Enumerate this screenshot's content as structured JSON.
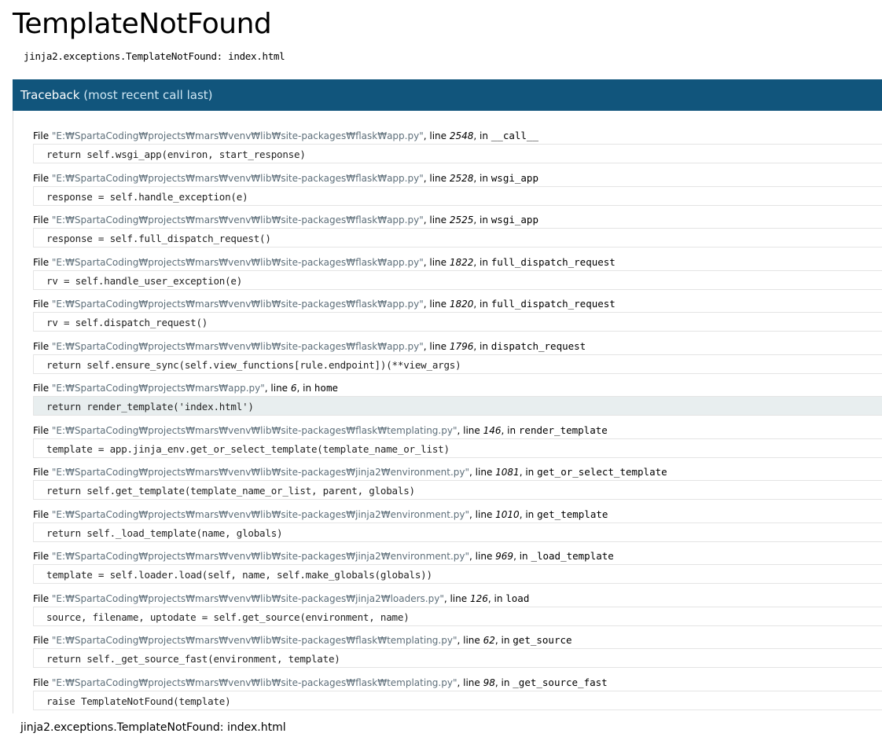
{
  "title": "TemplateNotFound",
  "error_message": "jinja2.exceptions.TemplateNotFound: index.html",
  "traceback": {
    "heading": "Traceback",
    "subheading": "(most recent call last)"
  },
  "frames": [
    {
      "file": "\"E:₩SpartaCoding₩projects₩mars₩venv₩lib₩site-packages₩flask₩app.py\"",
      "line": "2548",
      "func": "__call__",
      "code": "return self.wsgi_app(environ, start_response)"
    },
    {
      "file": "\"E:₩SpartaCoding₩projects₩mars₩venv₩lib₩site-packages₩flask₩app.py\"",
      "line": "2528",
      "func": "wsgi_app",
      "code": "response = self.handle_exception(e)"
    },
    {
      "file": "\"E:₩SpartaCoding₩projects₩mars₩venv₩lib₩site-packages₩flask₩app.py\"",
      "line": "2525",
      "func": "wsgi_app",
      "code": "response = self.full_dispatch_request()"
    },
    {
      "file": "\"E:₩SpartaCoding₩projects₩mars₩venv₩lib₩site-packages₩flask₩app.py\"",
      "line": "1822",
      "func": "full_dispatch_request",
      "code": "rv = self.handle_user_exception(e)"
    },
    {
      "file": "\"E:₩SpartaCoding₩projects₩mars₩venv₩lib₩site-packages₩flask₩app.py\"",
      "line": "1820",
      "func": "full_dispatch_request",
      "code": "rv = self.dispatch_request()"
    },
    {
      "file": "\"E:₩SpartaCoding₩projects₩mars₩venv₩lib₩site-packages₩flask₩app.py\"",
      "line": "1796",
      "func": "dispatch_request",
      "code": "return self.ensure_sync(self.view_functions[rule.endpoint])(**view_args)"
    },
    {
      "file": "\"E:₩SpartaCoding₩projects₩mars₩app.py\"",
      "line": "6",
      "func": "home",
      "code": "return render_template('index.html')",
      "highlight": true
    },
    {
      "file": "\"E:₩SpartaCoding₩projects₩mars₩venv₩lib₩site-packages₩flask₩templating.py\"",
      "line": "146",
      "func": "render_template",
      "code": "template = app.jinja_env.get_or_select_template(template_name_or_list)"
    },
    {
      "file": "\"E:₩SpartaCoding₩projects₩mars₩venv₩lib₩site-packages₩jinja2₩environment.py\"",
      "line": "1081",
      "func": "get_or_select_template",
      "code": "return self.get_template(template_name_or_list, parent, globals)"
    },
    {
      "file": "\"E:₩SpartaCoding₩projects₩mars₩venv₩lib₩site-packages₩jinja2₩environment.py\"",
      "line": "1010",
      "func": "get_template",
      "code": "return self._load_template(name, globals)"
    },
    {
      "file": "\"E:₩SpartaCoding₩projects₩mars₩venv₩lib₩site-packages₩jinja2₩environment.py\"",
      "line": "969",
      "func": "_load_template",
      "code": "template = self.loader.load(self, name, self.make_globals(globals))"
    },
    {
      "file": "\"E:₩SpartaCoding₩projects₩mars₩venv₩lib₩site-packages₩jinja2₩loaders.py\"",
      "line": "126",
      "func": "load",
      "code": "source, filename, uptodate = self.get_source(environment, name)"
    },
    {
      "file": "\"E:₩SpartaCoding₩projects₩mars₩venv₩lib₩site-packages₩flask₩templating.py\"",
      "line": "62",
      "func": "get_source",
      "code": "return self._get_source_fast(environment, template)"
    },
    {
      "file": "\"E:₩SpartaCoding₩projects₩mars₩venv₩lib₩site-packages₩flask₩templating.py\"",
      "line": "98",
      "func": "_get_source_fast",
      "code": "raise TemplateNotFound(template)"
    }
  ],
  "labels": {
    "file_prefix": "File ",
    "line_prefix": ", line ",
    "in_prefix": ", in "
  },
  "footer_error": "jinja2.exceptions.TemplateNotFound: index.html",
  "colors": {
    "header_bg": "#11557c",
    "header_sub": "#cfe7f4",
    "highlight_bg": "#e8eeef",
    "filename": "#5e6f7a"
  }
}
